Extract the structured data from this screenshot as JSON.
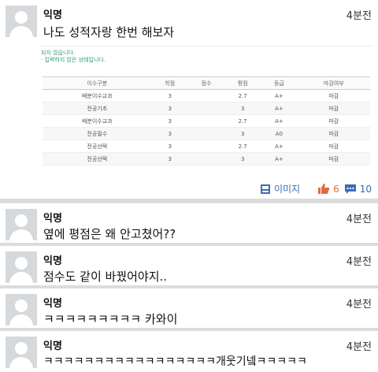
{
  "post": {
    "author": "익명",
    "time": "4분전",
    "text": "나도 성적자랑 한번 해보자",
    "image": {
      "notice1": "되지 않습니다.",
      "notice2": "· 입력하지 않은 상태입니다.",
      "headers": [
        "이수구분",
        "학점",
        "점수",
        "평점",
        "등급",
        "마감여부"
      ],
      "rows": [
        [
          "배분이수교과",
          "3",
          "",
          "2.7",
          "A+",
          "마감"
        ],
        [
          "전공기초",
          "3",
          "",
          "3",
          "A+",
          "마감"
        ],
        [
          "배분이수교과",
          "3",
          "",
          "2.7",
          "A+",
          "마감"
        ],
        [
          "전공필수",
          "3",
          "",
          "3",
          "A0",
          "마감"
        ],
        [
          "전공선택",
          "3",
          "",
          "2.7",
          "A+",
          "마감"
        ],
        [
          "전공선택",
          "3",
          "",
          "3",
          "A+",
          "마감"
        ]
      ]
    },
    "actions": {
      "image_label": "이미지",
      "likes": "6",
      "comments": "10"
    },
    "colors": {
      "image_link": "#3b6cb7",
      "like": "#e06b3c",
      "comment": "#3b6cb7"
    }
  },
  "comments": [
    {
      "author": "익명",
      "time": "4분전",
      "text": "옆에 평점은 왜 안고쳤어??"
    },
    {
      "author": "익명",
      "time": "4분전",
      "text": "점수도 같이 바꿨어야지.."
    },
    {
      "author": "익명",
      "time": "4분전",
      "text": "ㅋㅋㅋㅋㅋㅋㅋㅋㅋ 카와이"
    },
    {
      "author": "익명",
      "time": "4분전",
      "text": "ㅋㅋㅋㅋㅋㅋㅋㅋㅋㅋㅋㅋㅋㅋㅋㅋㅋ개웃기넼ㅋㅋㅋㅋㅋ"
    }
  ],
  "icons": [
    "avatar",
    "image-icon",
    "thumbs-up-icon",
    "comment-icon"
  ]
}
